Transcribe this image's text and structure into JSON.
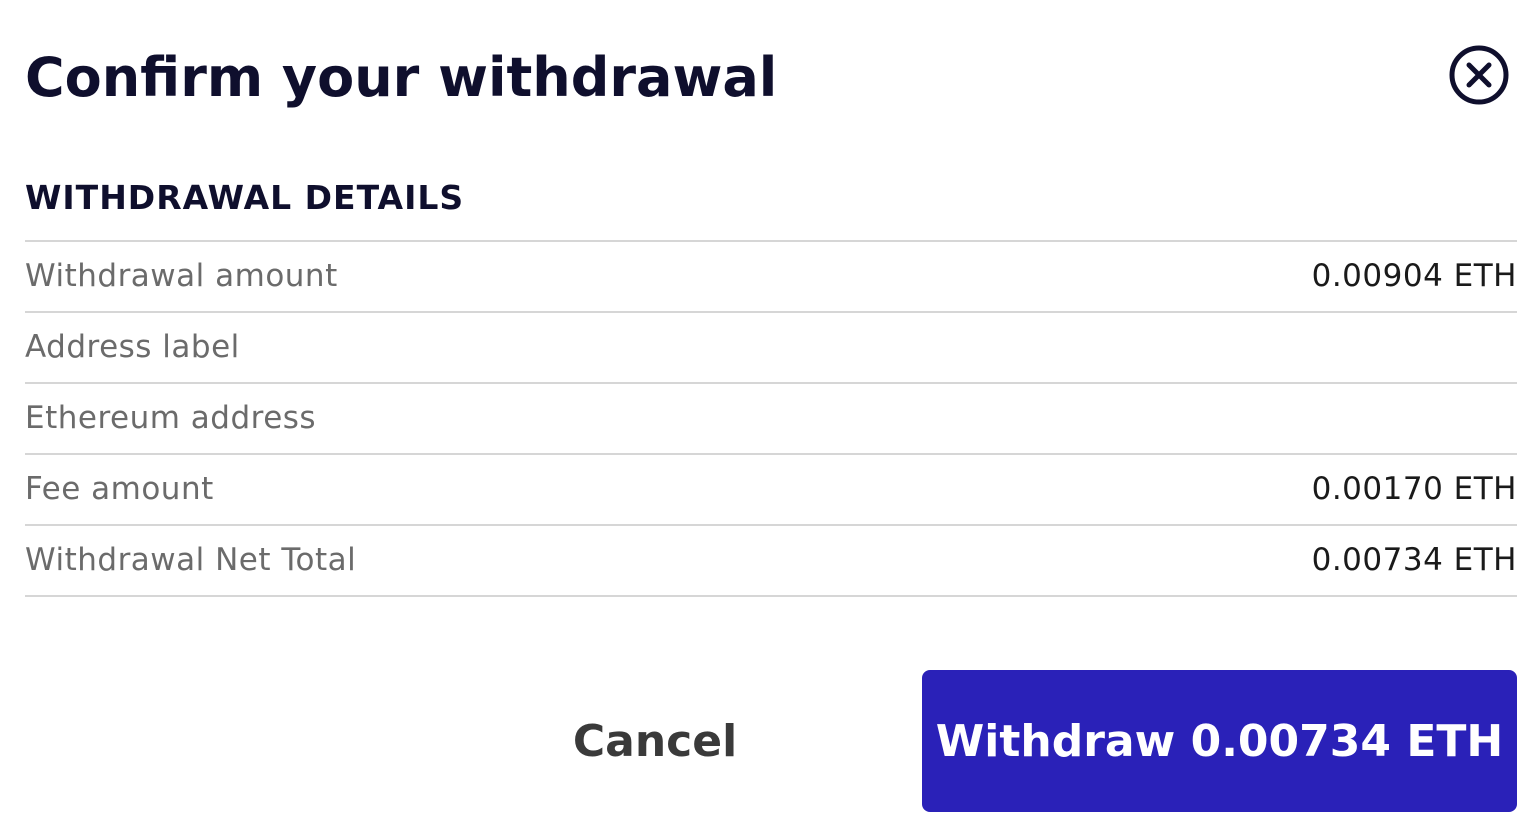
{
  "modal": {
    "title": "Confirm your withdrawal",
    "close_icon": "close-circle-icon"
  },
  "details": {
    "heading": "WITHDRAWAL DETAILS",
    "rows": [
      {
        "label": "Withdrawal amount",
        "value": "0.00904 ETH"
      },
      {
        "label": "Address label",
        "value": ""
      },
      {
        "label": "Ethereum address",
        "value": ""
      },
      {
        "label": "Fee amount",
        "value": "0.00170 ETH"
      },
      {
        "label": "Withdrawal Net Total",
        "value": "0.00734 ETH"
      }
    ]
  },
  "actions": {
    "cancel_label": "Cancel",
    "withdraw_label": "Withdraw 0.00734 ETH"
  },
  "colors": {
    "primary_button": "#2a21b8",
    "title_text": "#0f0f2d",
    "label_text": "#6b6b6b",
    "divider": "#d6d6d6"
  }
}
